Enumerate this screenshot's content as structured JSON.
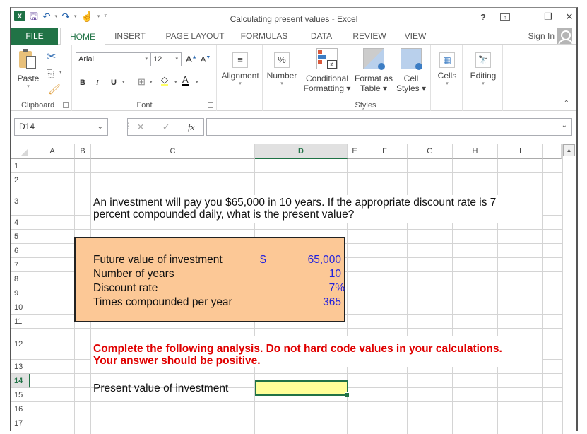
{
  "window": {
    "title": "Calculating present values - Excel",
    "controls": {
      "help": "?",
      "ribbon_display": "⊼",
      "minimize": "–",
      "restore": "❐",
      "close": "✕"
    }
  },
  "qat": {
    "logo": "X",
    "save": "💾",
    "undo": "↶",
    "redo": "↷",
    "touch": "☝",
    "customize": "⩱"
  },
  "tabs": [
    {
      "label": "FILE"
    },
    {
      "label": "HOME"
    },
    {
      "label": "INSERT"
    },
    {
      "label": "PAGE LAYOUT"
    },
    {
      "label": "FORMULAS"
    },
    {
      "label": "DATA"
    },
    {
      "label": "REVIEW"
    },
    {
      "label": "VIEW"
    }
  ],
  "sign_in": "Sign In",
  "ribbon": {
    "clipboard": {
      "label": "Clipboard",
      "paste": "Paste"
    },
    "font": {
      "label": "Font",
      "font_name": "Arial",
      "font_size": "12",
      "bold": "B",
      "italic": "I",
      "underline": "U",
      "grow": "A˄",
      "shrink": "A˅",
      "font_color": "A"
    },
    "alignment": {
      "label": "Alignment"
    },
    "number": {
      "label": "Number",
      "icon": "%"
    },
    "styles": {
      "label": "Styles",
      "conditional": [
        "Conditional",
        "Formatting ▾"
      ],
      "format_table": [
        "Format as",
        "Table ▾"
      ],
      "cell_styles": [
        "Cell",
        "Styles ▾"
      ]
    },
    "cells": {
      "label": "Cells"
    },
    "editing": {
      "label": "Editing"
    }
  },
  "formula_bar": {
    "name_box": "D14",
    "cancel": "✕",
    "enter": "✓",
    "fx": "fx",
    "value": ""
  },
  "columns": [
    "A",
    "B",
    "C",
    "D",
    "E",
    "F",
    "G",
    "H",
    "I"
  ],
  "selected_column": "D",
  "rows": [
    "1",
    "2",
    "3",
    "4",
    "5",
    "6",
    "7",
    "8",
    "9",
    "10",
    "11",
    "12",
    "13",
    "14",
    "15",
    "16",
    "17"
  ],
  "selected_row": "14",
  "sheet": {
    "question_line1": "An investment will pay you $65,000 in 10 years. If the appropriate discount rate is 7",
    "question_line2": "percent compounded daily, what is the present value?",
    "inputs": [
      {
        "label": "Future value of investment",
        "currency": "$",
        "value": "65,000"
      },
      {
        "label": "Number of years",
        "currency": "",
        "value": "10"
      },
      {
        "label": "Discount rate",
        "currency": "",
        "value": "7%"
      },
      {
        "label": "Times compounded per year",
        "currency": "",
        "value": "365"
      }
    ],
    "instruction_line1": "Complete the following analysis. Do not hard code values in your calculations.",
    "instruction_line2": "Your answer should be positive.",
    "output_label": "Present value of investment",
    "output_value": ""
  },
  "colors": {
    "excel_green": "#217346",
    "input_box": "#fcc896",
    "input_text": "#2222dd",
    "instruction_red": "#e00000",
    "answer_cell": "#ffff99"
  }
}
